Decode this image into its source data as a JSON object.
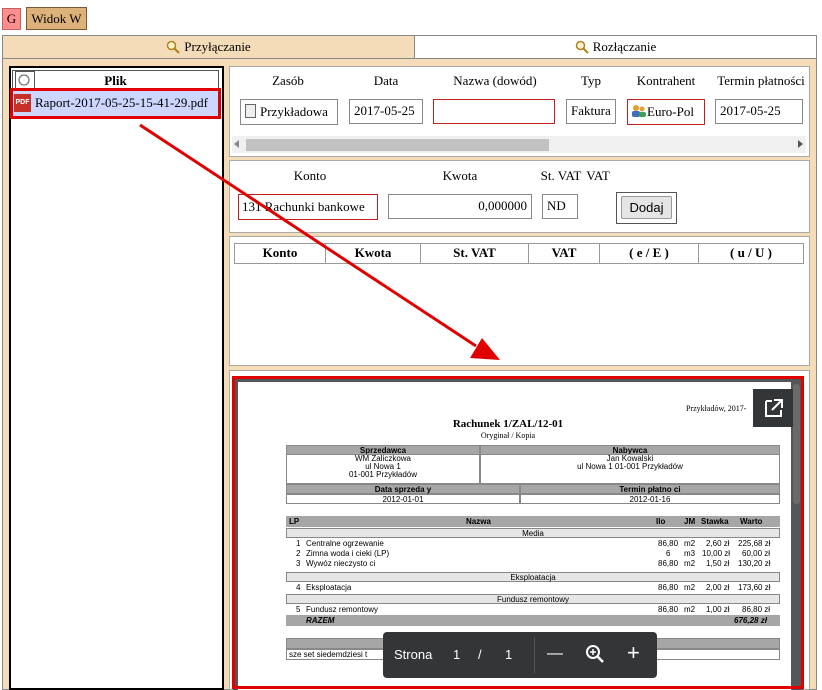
{
  "top": {
    "g_label": "G",
    "widok_label": "Widok W"
  },
  "tabs": [
    {
      "label": "Przyłączanie"
    },
    {
      "label": "Rozłączanie"
    }
  ],
  "file_list": {
    "header": "Plik",
    "files": [
      {
        "name": "Raport-2017-05-25-15-41-29.pdf",
        "icon": "pdf-file-icon"
      }
    ]
  },
  "doc_form": {
    "headers": {
      "resource": "Zasób",
      "date": "Data",
      "name": "Nazwa (dowód)",
      "type": "Typ",
      "contractor": "Kontrahent",
      "due": "Termin płatności"
    },
    "values": {
      "resource": "Przykładowa",
      "date": "2017-05-25",
      "name": "",
      "type": "Faktura",
      "contractor": "Euro-Pol",
      "due": "2017-05-25"
    }
  },
  "entry_form": {
    "headers": {
      "account": "Konto",
      "amount": "Kwota",
      "vat_rate": "St. VAT",
      "vat": "VAT"
    },
    "values": {
      "account": "131 Rachunki bankowe",
      "amount": "0,000000",
      "vat_rate": "ND"
    },
    "add_label": "Dodaj"
  },
  "entries_table": {
    "columns": [
      "Konto",
      "Kwota",
      "St. VAT",
      "VAT",
      "( e / E )",
      "( u / U )"
    ]
  },
  "pdf": {
    "toolbar": {
      "page_label": "Strona",
      "current_page": "1",
      "separator": "/",
      "total_pages": "1",
      "zoom_out": "—",
      "zoom_in": "+"
    },
    "document": {
      "place_date": "Przykładów, 2017-",
      "title": "Rachunek 1/ZAL/12-01",
      "subtitle": "Oryginał / Kopia",
      "seller_header": "Sprzedawca",
      "buyer_header": "Nabywca",
      "seller_lines": [
        "WM Zaliczkowa",
        "ul Nowa 1",
        "01-001 Przykładów"
      ],
      "buyer_lines": [
        "Jan Kowalski",
        "ul Nowa 1 01-001 Przykładów"
      ],
      "sale_date_header": "Data sprzeda y",
      "due_date_header": "Termin płatno ci",
      "sale_date": "2012-01-01",
      "due_date": "2012-01-16",
      "table_headers": [
        "LP",
        "Nazwa",
        "Ilo",
        "JM",
        "Stawka",
        "Warto"
      ],
      "groups": [
        {
          "name": "Media",
          "rows": [
            {
              "lp": "1",
              "name": "Centralne ogrzewanie",
              "qty": "86,80",
              "unit": "m2",
              "rate": "2,60 zł",
              "value": "225,68 zł"
            },
            {
              "lp": "2",
              "name": "Zimna woda i  cieki (LP)",
              "qty": "6",
              "unit": "m3",
              "rate": "10,00 zł",
              "value": "60,00 zł"
            },
            {
              "lp": "3",
              "name": "Wywóz nieczysto  ci",
              "qty": "86,80",
              "unit": "m2",
              "rate": "1,50 zł",
              "value": "130,20 zł"
            }
          ]
        },
        {
          "name": "Eksploatacja",
          "rows": [
            {
              "lp": "4",
              "name": "Eksploatacja",
              "qty": "86,80",
              "unit": "m2",
              "rate": "2,00 zł",
              "value": "173,60 zł"
            }
          ]
        },
        {
          "name": "Fundusz remontowy",
          "rows": [
            {
              "lp": "5",
              "name": "Fundusz remontowy",
              "qty": "86,80",
              "unit": "m2",
              "rate": "1,00 zł",
              "value": "86,80 zł"
            }
          ]
        }
      ],
      "total_label": "RAZEM",
      "total_value": "676,28 zł",
      "amount_words_header": "Kwota do zapłaty słownie",
      "amount_words": "sze   set siedemdziesi   t"
    }
  },
  "colors": {
    "tab_active": "#f5dcb8",
    "highlight_red": "#e10000",
    "file_selected": "#ccd6ff",
    "pdf_bg": "#525659",
    "toolbar": "#323639"
  }
}
